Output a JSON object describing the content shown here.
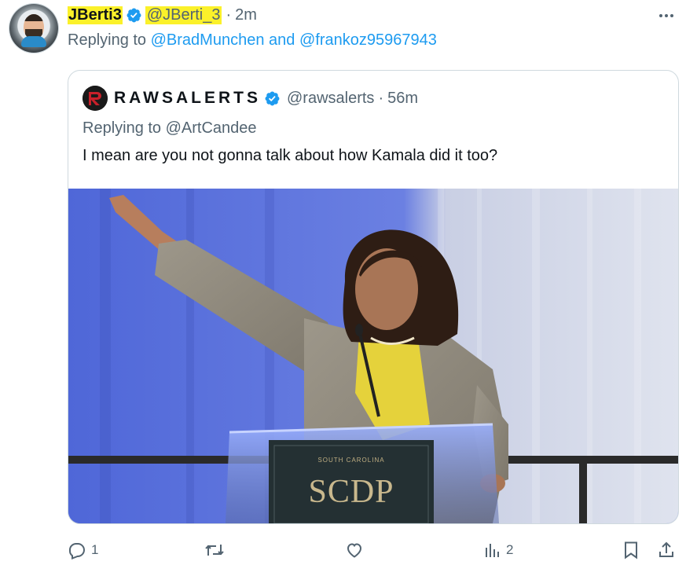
{
  "tweet": {
    "author_name": "JBerti3",
    "author_handle": "@JBerti_3",
    "separator": "·",
    "timestamp": "2m",
    "replying_prefix": "Replying to",
    "replying_to_1": "@BradMunchen",
    "replying_and": "and",
    "replying_to_2": "@frankoz95967943",
    "avatar_icon": "cartoon-avatar",
    "more_icon": "more-horizontal-icon",
    "highlight_color": "#fbf12a"
  },
  "quoted": {
    "author_name": "RAWSALERTS",
    "author_handle": "@rawsalerts",
    "separator": "·",
    "timestamp": "56m",
    "replying_prefix": "Replying to",
    "replying_to": "@ArtCandee",
    "text": "I mean are you not gonna talk about how Kamala did it too?",
    "media": {
      "podium_sign": "SCDP"
    }
  },
  "actions": {
    "reply": {
      "icon": "reply-icon",
      "count": "1"
    },
    "repost": {
      "icon": "repost-icon",
      "count": ""
    },
    "like": {
      "icon": "heart-icon",
      "count": ""
    },
    "views": {
      "icon": "analytics-icon",
      "count": "2"
    },
    "bookmark": {
      "icon": "bookmark-icon"
    },
    "share": {
      "icon": "share-icon"
    }
  },
  "colors": {
    "link": "#1d9bf0",
    "verified": "#1d9bf0",
    "secondary_text": "#536471"
  }
}
